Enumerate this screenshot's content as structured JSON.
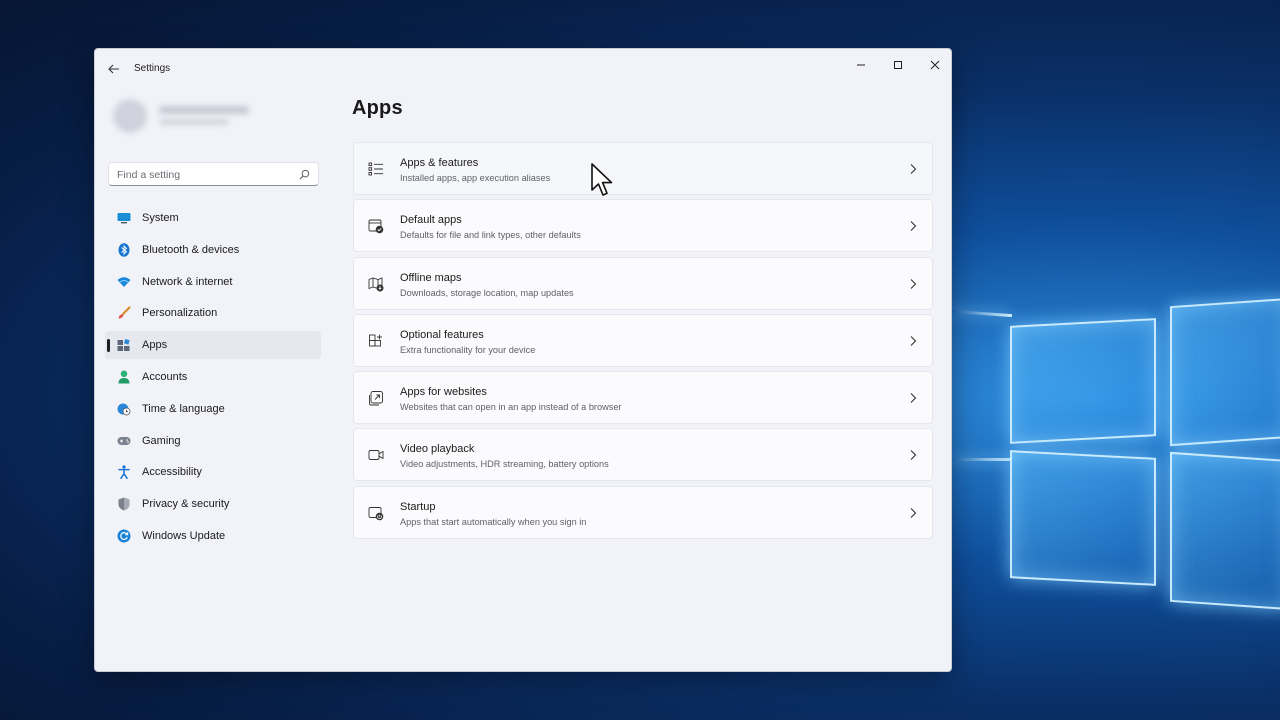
{
  "window": {
    "app_title": "Settings"
  },
  "search": {
    "placeholder": "Find a setting"
  },
  "sidebar": {
    "items": [
      {
        "label": "System",
        "icon": "monitor-icon",
        "color": "#1b8fd6"
      },
      {
        "label": "Bluetooth & devices",
        "icon": "bluetooth-icon",
        "color": "#1573d1"
      },
      {
        "label": "Network & internet",
        "icon": "wifi-icon",
        "color": "#1a86d9"
      },
      {
        "label": "Personalization",
        "icon": "brush-icon",
        "color": "#d98a2b"
      },
      {
        "label": "Apps",
        "icon": "apps-icon",
        "color": "#5c6677",
        "selected": true
      },
      {
        "label": "Accounts",
        "icon": "person-icon",
        "color": "#2bb37a"
      },
      {
        "label": "Time & language",
        "icon": "globe-clock-icon",
        "color": "#2b87d9"
      },
      {
        "label": "Gaming",
        "icon": "gamepad-icon",
        "color": "#7c8290"
      },
      {
        "label": "Accessibility",
        "icon": "accessibility-icon",
        "color": "#1a74d4"
      },
      {
        "label": "Privacy & security",
        "icon": "shield-icon",
        "color": "#7a7f8a"
      },
      {
        "label": "Windows Update",
        "icon": "update-icon",
        "color": "#1b84d6"
      }
    ]
  },
  "main": {
    "title": "Apps",
    "cards": [
      {
        "title": "Apps & features",
        "subtitle": "Installed apps, app execution aliases",
        "icon": "list-icon"
      },
      {
        "title": "Default apps",
        "subtitle": "Defaults for file and link types, other defaults",
        "icon": "default-apps-icon"
      },
      {
        "title": "Offline maps",
        "subtitle": "Downloads, storage location, map updates",
        "icon": "map-icon"
      },
      {
        "title": "Optional features",
        "subtitle": "Extra functionality for your device",
        "icon": "grid-plus-icon"
      },
      {
        "title": "Apps for websites",
        "subtitle": "Websites that can open in an app instead of a browser",
        "icon": "open-external-icon"
      },
      {
        "title": "Video playback",
        "subtitle": "Video adjustments, HDR streaming, battery options",
        "icon": "video-camera-icon"
      },
      {
        "title": "Startup",
        "subtitle": "Apps that start automatically when you sign in",
        "icon": "startup-icon"
      }
    ]
  }
}
